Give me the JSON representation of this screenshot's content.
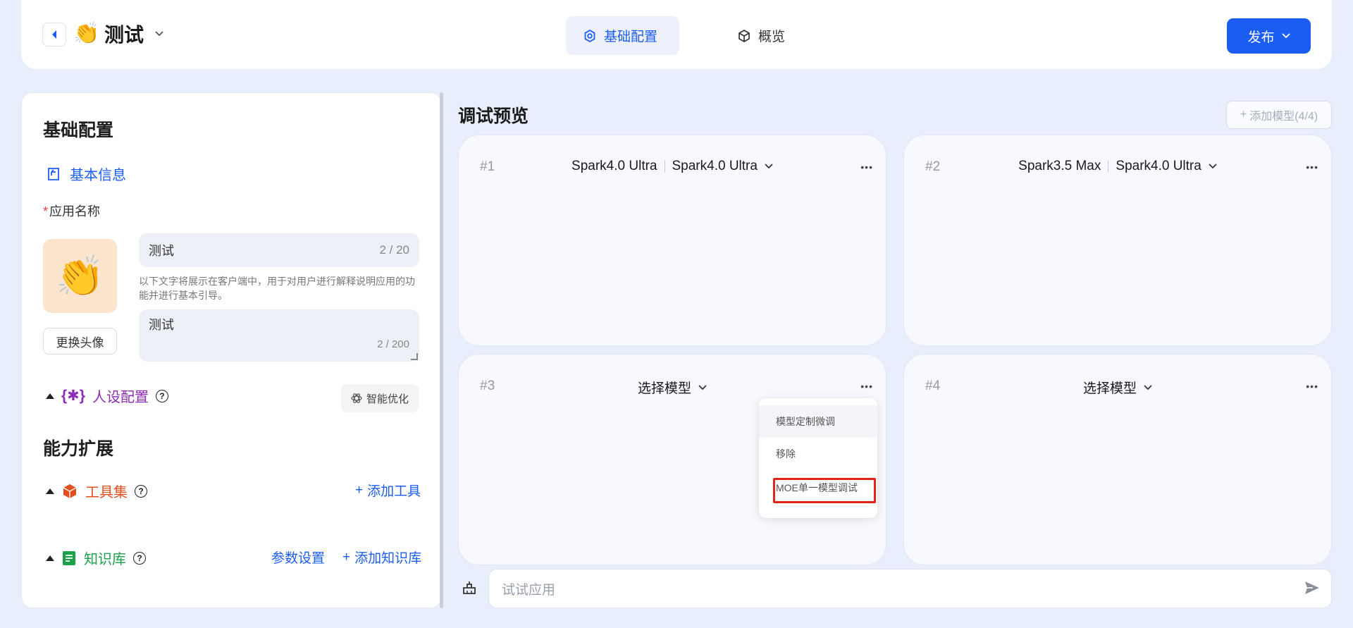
{
  "header": {
    "app_title": "测试",
    "app_emoji": "👏",
    "tabs": [
      {
        "label": "基础配置",
        "active": true
      },
      {
        "label": "概览",
        "active": false
      }
    ],
    "publish_label": "发布"
  },
  "left": {
    "title": "基础配置",
    "basic_info": "基本信息",
    "app_name_label": "应用名称",
    "app_name_value": "测试",
    "app_name_count": "2 / 20",
    "hint": "以下文字将展示在客户端中，用于对用户进行解释说明应用的功能并进行基本引导。",
    "desc_value": "测试",
    "desc_count": "2 / 200",
    "change_avatar": "更换头像",
    "persona": "人设配置",
    "smart_opt": "智能优化",
    "ability_title": "能力扩展",
    "tools": "工具集",
    "add_tool": "添加工具",
    "knowledge": "知识库",
    "param_settings": "参数设置",
    "add_knowledge": "添加知识库"
  },
  "right": {
    "title": "调试预览",
    "add_model": "添加模型(4/4)",
    "cards": [
      {
        "num": "#1",
        "model_a": "Spark4.0 Ultra",
        "model_b": "Spark4.0 Ultra"
      },
      {
        "num": "#2",
        "model_a": "Spark3.5 Max",
        "model_b": "Spark4.0 Ultra"
      },
      {
        "num": "#3",
        "model": "选择模型"
      },
      {
        "num": "#4",
        "model": "选择模型"
      }
    ],
    "menu": [
      "模型定制微调",
      "移除",
      "MOE单一模型调试"
    ],
    "chat_placeholder": "试试应用"
  },
  "colors": {
    "primary": "#1b5cf2",
    "persona": "#8e2ab8",
    "tools": "#e0501f",
    "knowledge": "#19a24a",
    "highlight": "#e5231b"
  }
}
